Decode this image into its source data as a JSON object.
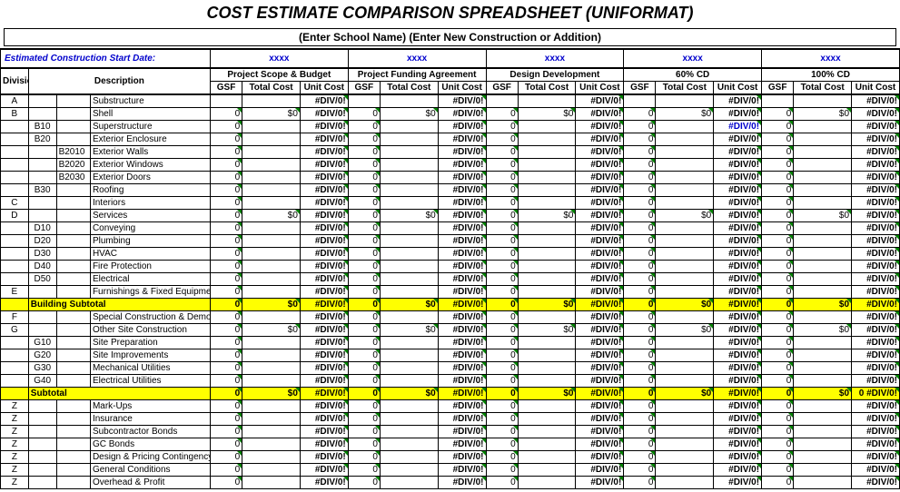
{
  "title": "COST ESTIMATE COMPARISON SPREADSHEET (UNIFORMAT)",
  "subtitle": "(Enter School Name) (Enter New Construction or Addition)",
  "date_label": "Estimated Construction Start Date:",
  "date_placeholder": "xxxx",
  "phases": [
    "Project Scope & Budget",
    "Project Funding Agreement",
    "Design Development",
    "60% CD",
    "100% CD"
  ],
  "measure_headers": [
    "GSF",
    "Total Cost",
    "Unit Cost"
  ],
  "div_header": {
    "div": "Division #",
    "desc": "Description"
  },
  "err": "#DIV/0!",
  "zero": "0",
  "zero_dollar": "$0",
  "rows": [
    {
      "div": "A",
      "sub": "",
      "code": "",
      "desc": "Substructure",
      "type": "div",
      "gsf": "",
      "tot": "",
      "unit": "#DIV/0!"
    },
    {
      "div": "B",
      "sub": "",
      "code": "",
      "desc": "Shell",
      "type": "div",
      "gsf": "0",
      "tot": "$0",
      "unit": "#DIV/0!"
    },
    {
      "div": "",
      "sub": "B10",
      "code": "",
      "desc": "Superstructure",
      "type": "sub",
      "gsf": "0",
      "tot": "",
      "unit": "#DIV/0!",
      "special60": true
    },
    {
      "div": "",
      "sub": "B20",
      "code": "",
      "desc": "Exterior Enclosure",
      "type": "sub",
      "gsf": "0",
      "tot": "",
      "unit": "#DIV/0!"
    },
    {
      "div": "",
      "sub": "",
      "code": "B2010",
      "desc": "Exterior Walls",
      "type": "item",
      "gsf": "0",
      "tot": "",
      "unit": "#DIV/0!"
    },
    {
      "div": "",
      "sub": "",
      "code": "B2020",
      "desc": "Exterior Windows",
      "type": "item",
      "gsf": "0",
      "tot": "",
      "unit": "#DIV/0!"
    },
    {
      "div": "",
      "sub": "",
      "code": "B2030",
      "desc": "Exterior Doors",
      "type": "item",
      "gsf": "0",
      "tot": "",
      "unit": "#DIV/0!"
    },
    {
      "div": "",
      "sub": "B30",
      "code": "",
      "desc": "Roofing",
      "type": "sub",
      "gsf": "0",
      "tot": "",
      "unit": "#DIV/0!"
    },
    {
      "div": "C",
      "sub": "",
      "code": "",
      "desc": "Interiors",
      "type": "div",
      "gsf": "0",
      "tot": "",
      "unit": "#DIV/0!"
    },
    {
      "div": "D",
      "sub": "",
      "code": "",
      "desc": "Services",
      "type": "div",
      "gsf": "0",
      "tot": "$0",
      "unit": "#DIV/0!"
    },
    {
      "div": "",
      "sub": "D10",
      "code": "",
      "desc": "Conveying",
      "type": "sub",
      "gsf": "0",
      "tot": "",
      "unit": "#DIV/0!"
    },
    {
      "div": "",
      "sub": "D20",
      "code": "",
      "desc": "Plumbing",
      "type": "sub",
      "gsf": "0",
      "tot": "",
      "unit": "#DIV/0!"
    },
    {
      "div": "",
      "sub": "D30",
      "code": "",
      "desc": "HVAC",
      "type": "sub",
      "gsf": "0",
      "tot": "",
      "unit": "#DIV/0!"
    },
    {
      "div": "",
      "sub": "D40",
      "code": "",
      "desc": "Fire Protection",
      "type": "sub",
      "gsf": "0",
      "tot": "",
      "unit": "#DIV/0!"
    },
    {
      "div": "",
      "sub": "D50",
      "code": "",
      "desc": "Electrical",
      "type": "sub",
      "gsf": "0",
      "tot": "",
      "unit": "#DIV/0!"
    },
    {
      "div": "E",
      "sub": "",
      "code": "",
      "desc": "Furnishings & Fixed Equipment",
      "type": "div",
      "gsf": "0",
      "tot": "",
      "unit": "#DIV/0!"
    }
  ],
  "building_subtotal_label": "Building Subtotal",
  "rows2": [
    {
      "div": "F",
      "sub": "",
      "code": "",
      "desc": "Special Construction & Demo",
      "type": "div",
      "gsf": "0",
      "tot": "",
      "unit": "#DIV/0!"
    },
    {
      "div": "G",
      "sub": "",
      "code": "",
      "desc": "Other Site Construction",
      "type": "div",
      "gsf": "0",
      "tot": "$0",
      "unit": "#DIV/0!"
    },
    {
      "div": "",
      "sub": "G10",
      "code": "",
      "desc": "Site Preparation",
      "type": "sub",
      "gsf": "0",
      "tot": "",
      "unit": "#DIV/0!"
    },
    {
      "div": "",
      "sub": "G20",
      "code": "",
      "desc": "Site Improvements",
      "type": "sub",
      "gsf": "0",
      "tot": "",
      "unit": "#DIV/0!"
    },
    {
      "div": "",
      "sub": "G30",
      "code": "",
      "desc": "Mechanical Utilities",
      "type": "sub",
      "gsf": "0",
      "tot": "",
      "unit": "#DIV/0!"
    },
    {
      "div": "",
      "sub": "G40",
      "code": "",
      "desc": "Electrical Utilities",
      "type": "sub",
      "gsf": "0",
      "tot": "",
      "unit": "#DIV/0!"
    }
  ],
  "subtotal_label": "Subtotal",
  "rows3": [
    {
      "div": "Z",
      "sub": "",
      "code": "",
      "desc": "Mark-Ups",
      "type": "div",
      "gsf": "0",
      "tot": "",
      "unit": "#DIV/0!"
    },
    {
      "div": "Z",
      "sub": "",
      "code": "",
      "desc": "Insurance",
      "type": "sub",
      "gsf": "0",
      "tot": "",
      "unit": "#DIV/0!"
    },
    {
      "div": "Z",
      "sub": "",
      "code": "",
      "desc": "Subcontractor Bonds",
      "type": "sub",
      "gsf": "0",
      "tot": "",
      "unit": "#DIV/0!"
    },
    {
      "div": "Z",
      "sub": "",
      "code": "",
      "desc": "GC Bonds",
      "type": "sub",
      "gsf": "0",
      "tot": "",
      "unit": "#DIV/0!"
    },
    {
      "div": "Z",
      "sub": "",
      "code": "",
      "desc": "Design & Pricing Contingency",
      "type": "sub",
      "gsf": "0",
      "tot": "",
      "unit": "#DIV/0!"
    },
    {
      "div": "Z",
      "sub": "",
      "code": "",
      "desc": "General Conditions",
      "type": "sub",
      "gsf": "0",
      "tot": "",
      "unit": "#DIV/0!"
    },
    {
      "div": "Z",
      "sub": "",
      "code": "",
      "desc": "Overhead & Profit",
      "type": "sub",
      "gsf": "0",
      "tot": "",
      "unit": "#DIV/0!"
    }
  ],
  "subtotal_vals": {
    "gsf": "0",
    "tot": "$0",
    "unit": "#DIV/0!",
    "trailing": "0"
  }
}
